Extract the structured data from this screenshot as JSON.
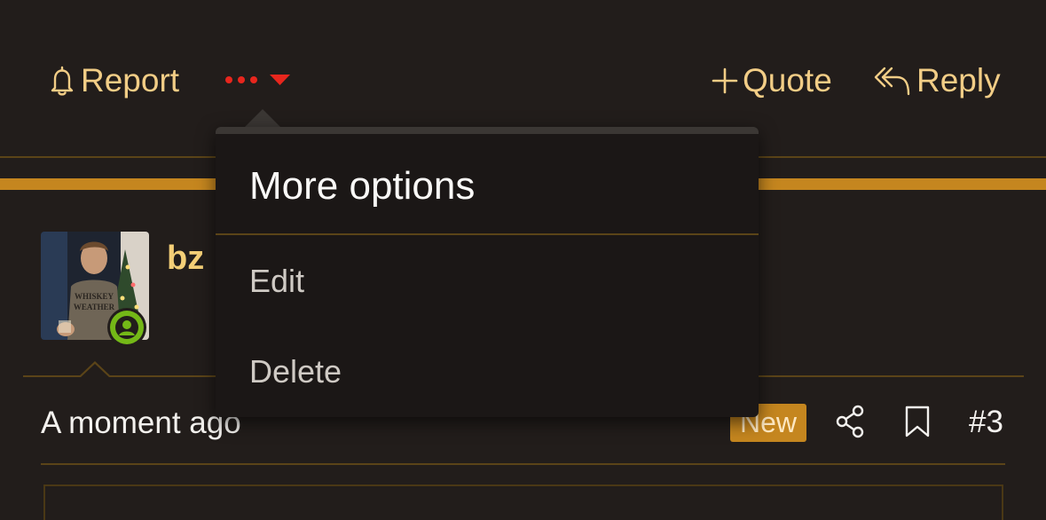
{
  "toolbar": {
    "report_label": "Report",
    "quote_label": "Quote",
    "reply_label": "Reply",
    "more_icon": "ellipsis-icon",
    "accent_color": "#f2cd86",
    "more_color": "#e8261d"
  },
  "post": {
    "username_partial": "bz",
    "timestamp": "A moment ago",
    "badge": "New",
    "post_number": "#3",
    "avatar_shirt_text": "WHISKEY WEATHER"
  },
  "menu": {
    "title": "More options",
    "items": [
      {
        "label": "Edit"
      },
      {
        "label": "Delete"
      }
    ]
  },
  "colors": {
    "background": "#221d1b",
    "gold": "#c5861f",
    "online": "#74b817"
  }
}
